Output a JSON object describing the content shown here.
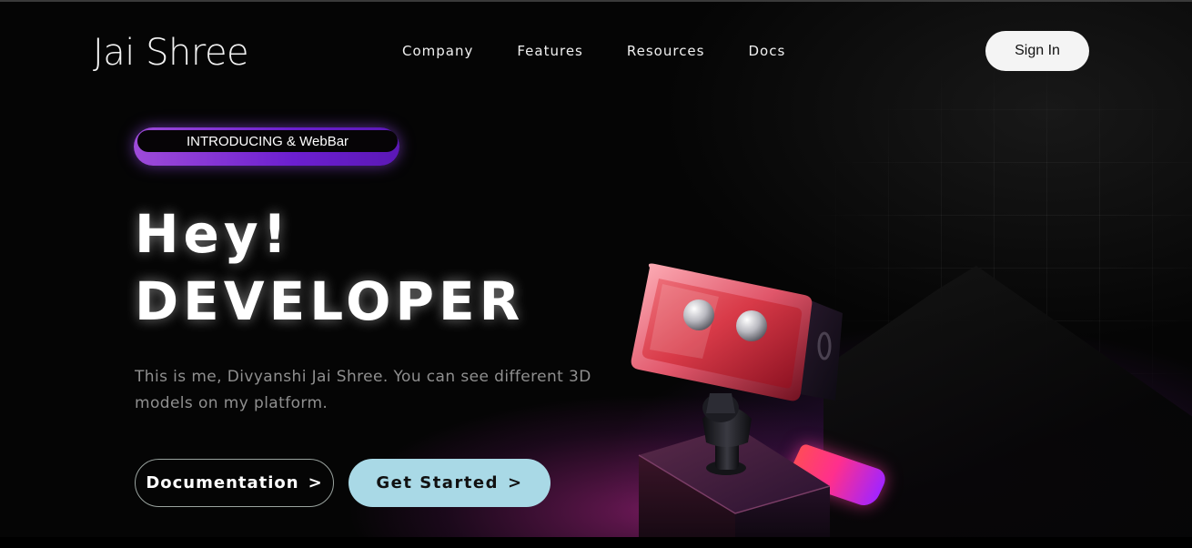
{
  "header": {
    "logo": "Jai Shree",
    "nav": [
      "Company",
      "Features",
      "Resources",
      "Docs"
    ],
    "signin_label": "Sign In"
  },
  "intro": {
    "pill_label": "INTRODUCING & WebBar"
  },
  "hero": {
    "line1": "Hey!",
    "line2": "DEVELOPER",
    "subtitle": "This is me, Divyanshi Jai Shree. You can see different 3D models on my platform."
  },
  "buttons": {
    "documentation": "Documentation",
    "get_started": "Get Started",
    "chevron": ">"
  },
  "colors": {
    "background": "#050505",
    "accent_purple": "#6c1fd0",
    "get_started_bg": "#a9d9e6",
    "robot_face": "#e0434f"
  },
  "illustration": {
    "icon": "robot-3d-icon"
  }
}
